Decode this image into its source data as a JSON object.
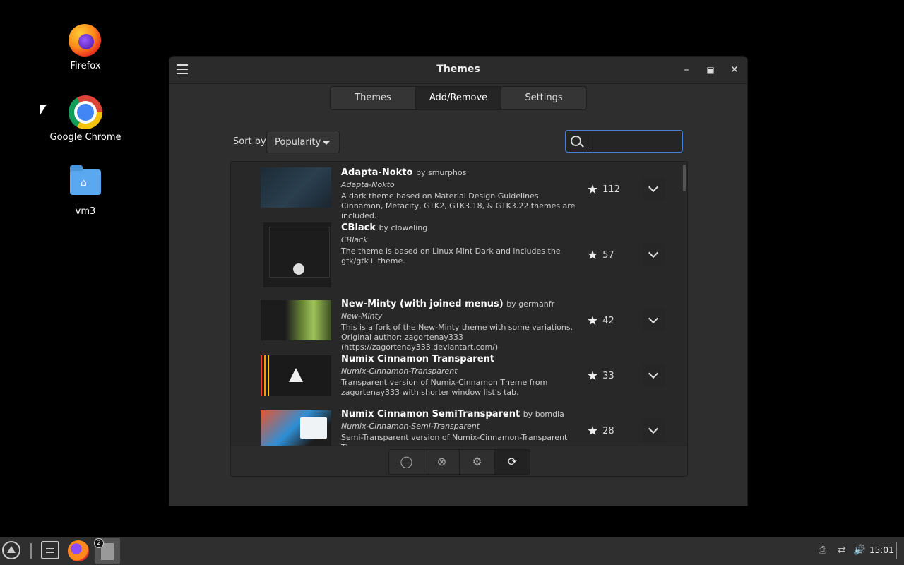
{
  "desktop": {
    "icons": [
      {
        "label": "Firefox"
      },
      {
        "label": "Google Chrome"
      },
      {
        "label": "vm3"
      }
    ]
  },
  "window": {
    "title": "Themes",
    "tabs": [
      {
        "label": "Themes",
        "active": false
      },
      {
        "label": "Add/Remove",
        "active": true
      },
      {
        "label": "Settings",
        "active": false
      }
    ],
    "sort": {
      "label": "Sort by",
      "value": "Popularity"
    },
    "search": {
      "value": "",
      "placeholder": ""
    },
    "themes": [
      {
        "name": "Adapta-Nokto",
        "author": "by smurphos",
        "uuid": "Adapta-Nokto",
        "description": "A dark theme based on Material Design Guidelines. Cinnamon, Metacity, GTK2, GTK3.18, & GTK3.22 themes are included.",
        "rating": "112"
      },
      {
        "name": "CBlack",
        "author": "by cloweling",
        "uuid": "CBlack",
        "description": "The theme is based on Linux Mint Dark and includes the gtk/gtk+ theme.",
        "rating": "57"
      },
      {
        "name": "New-Minty (with joined menus)",
        "author": "by germanfr",
        "uuid": "New-Minty",
        "description": "This is a fork of the New-Minty theme with some variations. Original author: zagortenay333 (https://zagortenay333.deviantart.com/)",
        "rating": "42"
      },
      {
        "name": "Numix Cinnamon Transparent",
        "author": "",
        "uuid": "Numix-Cinnamon-Transparent",
        "description": "Transparent version of Numix-Cinnamon Theme from zagortenay333 with shorter window list's tab.",
        "rating": "33"
      },
      {
        "name": "Numix Cinnamon SemiTransparent",
        "author": "by bomdia",
        "uuid": "Numix-Cinnamon-Semi-Transparent",
        "description": "Semi-Transparent version of Numix-Cinnamon-Transparent Theme",
        "rating": "28"
      }
    ],
    "toolbar_icons": [
      "lightbulb-icon",
      "remove-circle-icon",
      "gear-icon",
      "refresh-icon"
    ]
  },
  "taskbar": {
    "window_badge": "2",
    "clock": "15:01"
  }
}
